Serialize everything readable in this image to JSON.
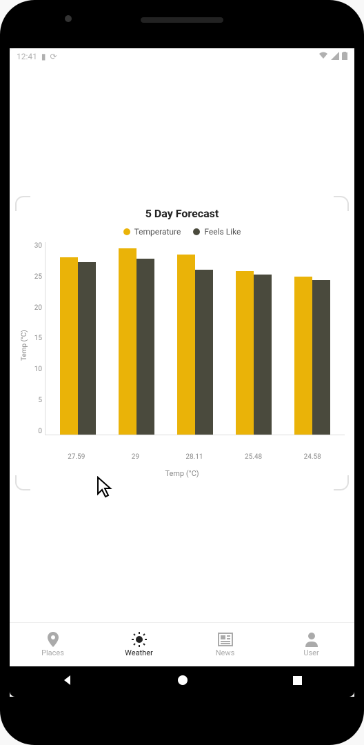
{
  "status": {
    "time": "12:41",
    "battery_icon": "▮",
    "sync_icon": "⟳"
  },
  "chart_data": {
    "type": "bar",
    "title": "5 Day Forecast",
    "xlabel": "Temp (°C)",
    "ylabel": "Temp (°C)",
    "ylim": [
      0,
      30
    ],
    "yticks": [
      30,
      25,
      20,
      15,
      10,
      5,
      0
    ],
    "categories": [
      "27.59",
      "29",
      "28.11",
      "25.48",
      "24.58"
    ],
    "series": [
      {
        "name": "Temperature",
        "color": "#eab308",
        "values": [
          27.59,
          29.0,
          28.11,
          25.48,
          24.58
        ]
      },
      {
        "name": "Feels Like",
        "color": "#4a4a3d",
        "values": [
          26.9,
          27.4,
          25.7,
          24.9,
          24.1
        ]
      }
    ]
  },
  "nav": {
    "items": [
      {
        "key": "places",
        "label": "Places",
        "active": false
      },
      {
        "key": "weather",
        "label": "Weather",
        "active": true
      },
      {
        "key": "news",
        "label": "News",
        "active": false
      },
      {
        "key": "user",
        "label": "User",
        "active": false
      }
    ]
  }
}
